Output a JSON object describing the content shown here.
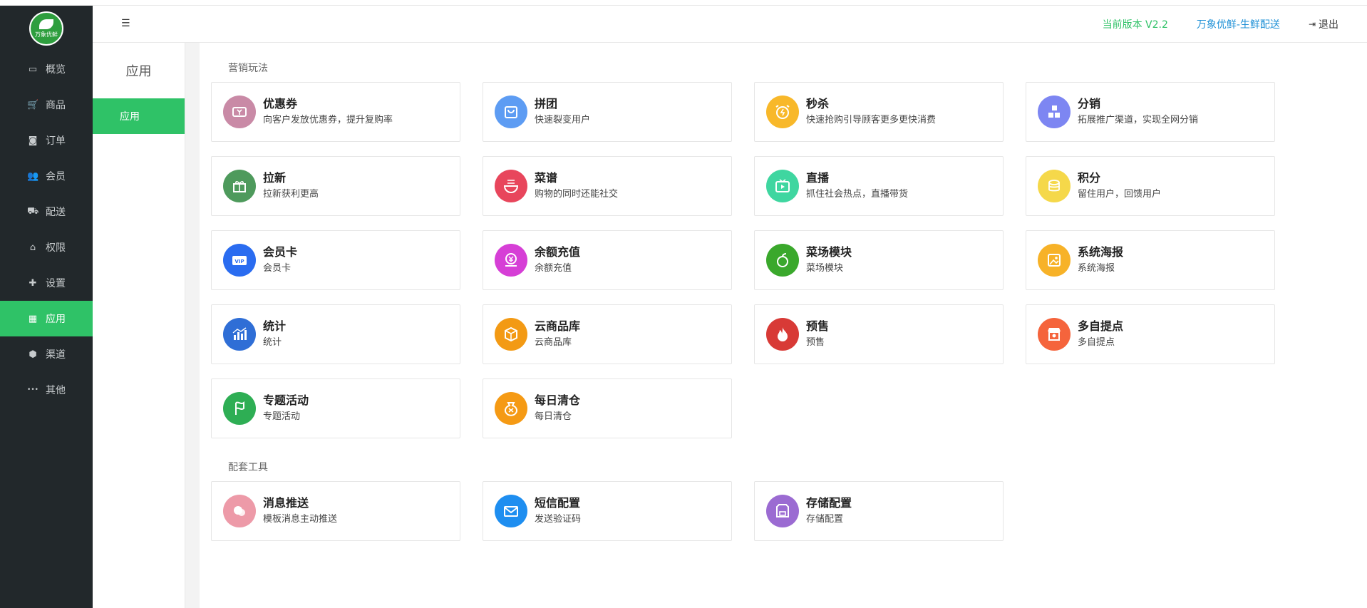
{
  "logo": {
    "text": "万象优鲜"
  },
  "sidebar": {
    "items": [
      {
        "label": "概览",
        "icon": "monitor-icon"
      },
      {
        "label": "商品",
        "icon": "cart-icon"
      },
      {
        "label": "订单",
        "icon": "money-icon"
      },
      {
        "label": "会员",
        "icon": "users-icon"
      },
      {
        "label": "配送",
        "icon": "truck-icon"
      },
      {
        "label": "权限",
        "icon": "bank-icon"
      },
      {
        "label": "设置",
        "icon": "puzzle-icon"
      },
      {
        "label": "应用",
        "icon": "app-icon",
        "active": true
      },
      {
        "label": "渠道",
        "icon": "cube-icon"
      },
      {
        "label": "其他",
        "icon": "more-icon"
      }
    ]
  },
  "topbar": {
    "version": "当前版本 V2.2",
    "shop": "万象优鲜-生鲜配送",
    "logout": "退出"
  },
  "subnav": {
    "title": "应用",
    "item": "应用"
  },
  "sections": {
    "marketing": "营销玩法",
    "tools": "配套工具"
  },
  "colors": {
    "accent": "#2fc267",
    "sidebar_bg": "#22282b"
  },
  "marketing_cards": [
    {
      "title": "优惠券",
      "desc": "向客户发放优惠券，提升复购率",
      "icon": "coupon-icon",
      "color": "#c98aa6"
    },
    {
      "title": "拼团",
      "desc": "快速裂变用户",
      "icon": "bag-icon",
      "color": "#5d9cf3"
    },
    {
      "title": "秒杀",
      "desc": "快速抢购引导顾客更多更快消费",
      "icon": "alarm-icon",
      "color": "#f8b82a"
    },
    {
      "title": "分销",
      "desc": "拓展推广渠道，实现全网分销",
      "icon": "blocks-icon",
      "color": "#7d86f2"
    },
    {
      "title": "拉新",
      "desc": "拉新获利更高",
      "icon": "gift-icon",
      "color": "#4e9a5c"
    },
    {
      "title": "菜谱",
      "desc": "购物的同时还能社交",
      "icon": "bowl-icon",
      "color": "#e8465c"
    },
    {
      "title": "直播",
      "desc": "抓住社会热点，直播带货",
      "icon": "live-icon",
      "color": "#3fd6a0"
    },
    {
      "title": "积分",
      "desc": "留住用户，回馈用户",
      "icon": "coins-icon",
      "color": "#f5d84a"
    },
    {
      "title": "会员卡",
      "desc": "会员卡",
      "icon": "vip-icon",
      "color": "#2a6cf0"
    },
    {
      "title": "余额充值",
      "desc": "余额充值",
      "icon": "recharge-icon",
      "color": "#d63fd6"
    },
    {
      "title": "菜场模块",
      "desc": "菜场模块",
      "icon": "market-icon",
      "color": "#3aa82c"
    },
    {
      "title": "系统海报",
      "desc": "系统海报",
      "icon": "poster-icon",
      "color": "#f7b228"
    },
    {
      "title": "统计",
      "desc": "统计",
      "icon": "stats-icon",
      "color": "#2f6ed6"
    },
    {
      "title": "云商品库",
      "desc": "云商品库",
      "icon": "box-icon",
      "color": "#f39a14"
    },
    {
      "title": "预售",
      "desc": "预售",
      "icon": "fire-icon",
      "color": "#d83a36"
    },
    {
      "title": "多自提点",
      "desc": "多自提点",
      "icon": "store-icon",
      "color": "#f5643c"
    },
    {
      "title": "专题活动",
      "desc": "专题活动",
      "icon": "flag-icon",
      "color": "#2eae54"
    },
    {
      "title": "每日清仓",
      "desc": "每日清仓",
      "icon": "moneybag-icon",
      "color": "#f59a14"
    }
  ],
  "tool_cards": [
    {
      "title": "消息推送",
      "desc": "模板消息主动推送",
      "icon": "message-icon",
      "color": "#ed9aa8"
    },
    {
      "title": "短信配置",
      "desc": "发送验证码",
      "icon": "mail-icon",
      "color": "#1e8ef0"
    },
    {
      "title": "存储配置",
      "desc": "存储配置",
      "icon": "sdcard-icon",
      "color": "#9b6bd2"
    }
  ]
}
